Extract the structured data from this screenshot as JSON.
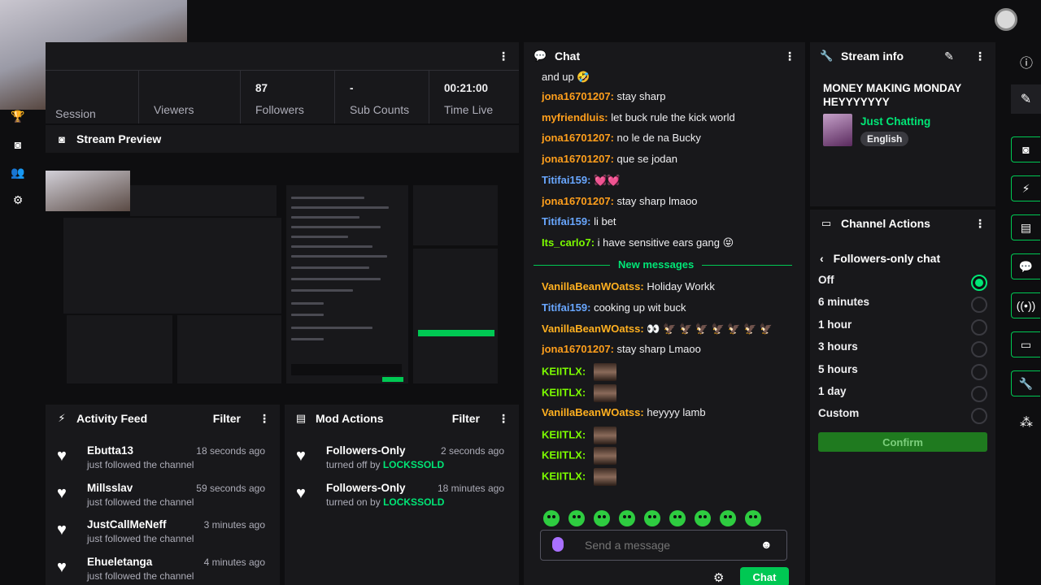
{
  "topbar": {
    "avatar_icon": "profile-badge-icon"
  },
  "stats": [
    {
      "value": "",
      "label": "Session"
    },
    {
      "value": "",
      "label": "Viewers"
    },
    {
      "value": "87",
      "label": "Followers"
    },
    {
      "value": "-",
      "label": "Sub Counts"
    },
    {
      "value": "00:21:00",
      "label": "Time Live"
    }
  ],
  "stream_preview": {
    "title": "Stream Preview"
  },
  "activity_feed": {
    "title": "Activity Feed",
    "filter_label": "Filter",
    "items": [
      {
        "name": "Ebutta13",
        "time": "18 seconds ago",
        "detail": "just followed the channel"
      },
      {
        "name": "Millsslav",
        "time": "59 seconds ago",
        "detail": "just followed the channel"
      },
      {
        "name": "JustCallMeNeff",
        "time": "3 minutes ago",
        "detail": "just followed the channel"
      },
      {
        "name": "Ehueletanga",
        "time": "4 minutes ago",
        "detail": "just followed the channel"
      }
    ]
  },
  "mod_actions": {
    "title": "Mod Actions",
    "filter_label": "Filter",
    "items": [
      {
        "name": "Followers-Only",
        "time": "2 seconds ago",
        "detail_prefix": "turned off by",
        "moderator": "LOCKSSOLD"
      },
      {
        "name": "Followers-Only",
        "time": "18 minutes ago",
        "detail_prefix": "turned on by",
        "moderator": "LOCKSSOLD"
      }
    ]
  },
  "chat": {
    "title": "Chat",
    "partial_line": "and up 🤣",
    "messages_before": [
      {
        "user": "jona16701207",
        "color": "or",
        "text": "stay sharp"
      },
      {
        "user": "myfriendluis",
        "color": "or",
        "text": "let buck rule the kick world"
      },
      {
        "user": "jona16701207",
        "color": "or",
        "text": "no le de na Bucky"
      },
      {
        "user": "jona16701207",
        "color": "or",
        "text": "que se jodan"
      },
      {
        "user": "Titifai159",
        "color": "bl",
        "text": "💓💓"
      },
      {
        "user": "jona16701207",
        "color": "or",
        "text": "stay sharp lmaoo"
      },
      {
        "user": "Titifai159",
        "color": "bl",
        "text": "li bet"
      },
      {
        "user": "Its_carlo7",
        "color": "gr",
        "text": "i have sensitive ears gang 😝"
      }
    ],
    "new_messages_label": "New messages",
    "messages_after": [
      {
        "user": "VanillaBeanWOatss",
        "color": "yl",
        "text": "Holiday Workk",
        "emote_count": 0
      },
      {
        "user": "Titifai159",
        "color": "bl",
        "text": "cooking up wit buck",
        "emote_count": 0
      },
      {
        "user": "VanillaBeanWOatss",
        "color": "yl",
        "text": "👀 🦅 🦅 🦅 🦅 🦅 🦅 🦅",
        "emote_count": 0
      },
      {
        "user": "jona16701207",
        "color": "or",
        "text": "stay sharp Lmaoo",
        "emote_count": 0
      },
      {
        "user": "KEIITLX",
        "color": "gr",
        "text": "",
        "emote_count": 1
      },
      {
        "user": "KEIITLX",
        "color": "gr",
        "text": "",
        "emote_count": 1
      },
      {
        "user": "VanillaBeanWOatss",
        "color": "yl",
        "text": "heyyyy lamb",
        "emote_count": 0
      },
      {
        "user": "KEIITLX",
        "color": "gr",
        "text": "",
        "emote_count": 1
      },
      {
        "user": "KEIITLX",
        "color": "gr",
        "text": "",
        "emote_count": 1
      },
      {
        "user": "KEIITLX",
        "color": "gr",
        "text": "",
        "emote_count": 1
      }
    ],
    "input_placeholder": "Send a message",
    "send_label": "Chat"
  },
  "stream_info": {
    "title": "Stream info",
    "stream_title": "MONEY MAKING MONDAY HEYYYYYYY",
    "category": "Just Chatting",
    "language": "English"
  },
  "channel_actions": {
    "title": "Channel Actions",
    "subtitle": "Followers-only chat",
    "options": [
      {
        "label": "Off",
        "selected": true
      },
      {
        "label": "6 minutes",
        "selected": false
      },
      {
        "label": "1 hour",
        "selected": false
      },
      {
        "label": "3 hours",
        "selected": false
      },
      {
        "label": "5 hours",
        "selected": false
      },
      {
        "label": "1 day",
        "selected": false
      },
      {
        "label": "Custom",
        "selected": false
      }
    ],
    "confirm_label": "Confirm"
  },
  "colors": {
    "accent": "#00e676",
    "confirm_bg": "#1f7a1f",
    "panel": "#18181b",
    "background": "#0e0e10"
  }
}
